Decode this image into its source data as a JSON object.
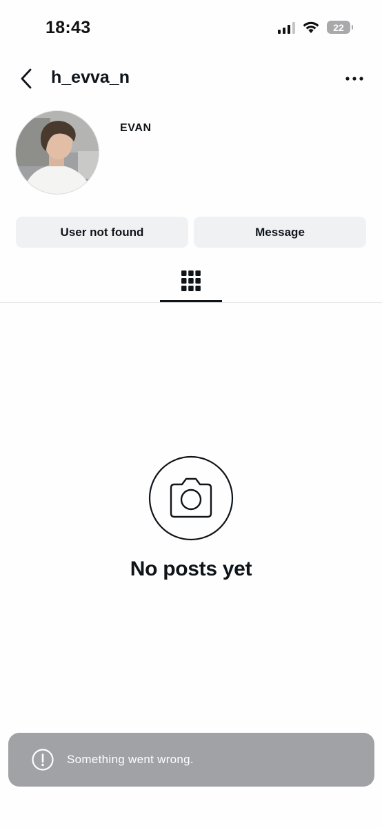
{
  "status_bar": {
    "time": "18:43",
    "battery": "22"
  },
  "header": {
    "username": "h_evva_n"
  },
  "profile": {
    "display_name": "EVAN"
  },
  "actions": {
    "user_not_found_label": "User not found",
    "message_label": "Message"
  },
  "tabs": {
    "active": "grid-icon"
  },
  "empty_state": {
    "text": "No posts yet",
    "icon": "camera-icon"
  },
  "toast": {
    "message": "Something went wrong.",
    "icon": "exclamation-circle-icon"
  },
  "colors": {
    "button_bg": "#eff1f3",
    "toast_bg": "#a1a2a6",
    "text": "#0f1419"
  }
}
